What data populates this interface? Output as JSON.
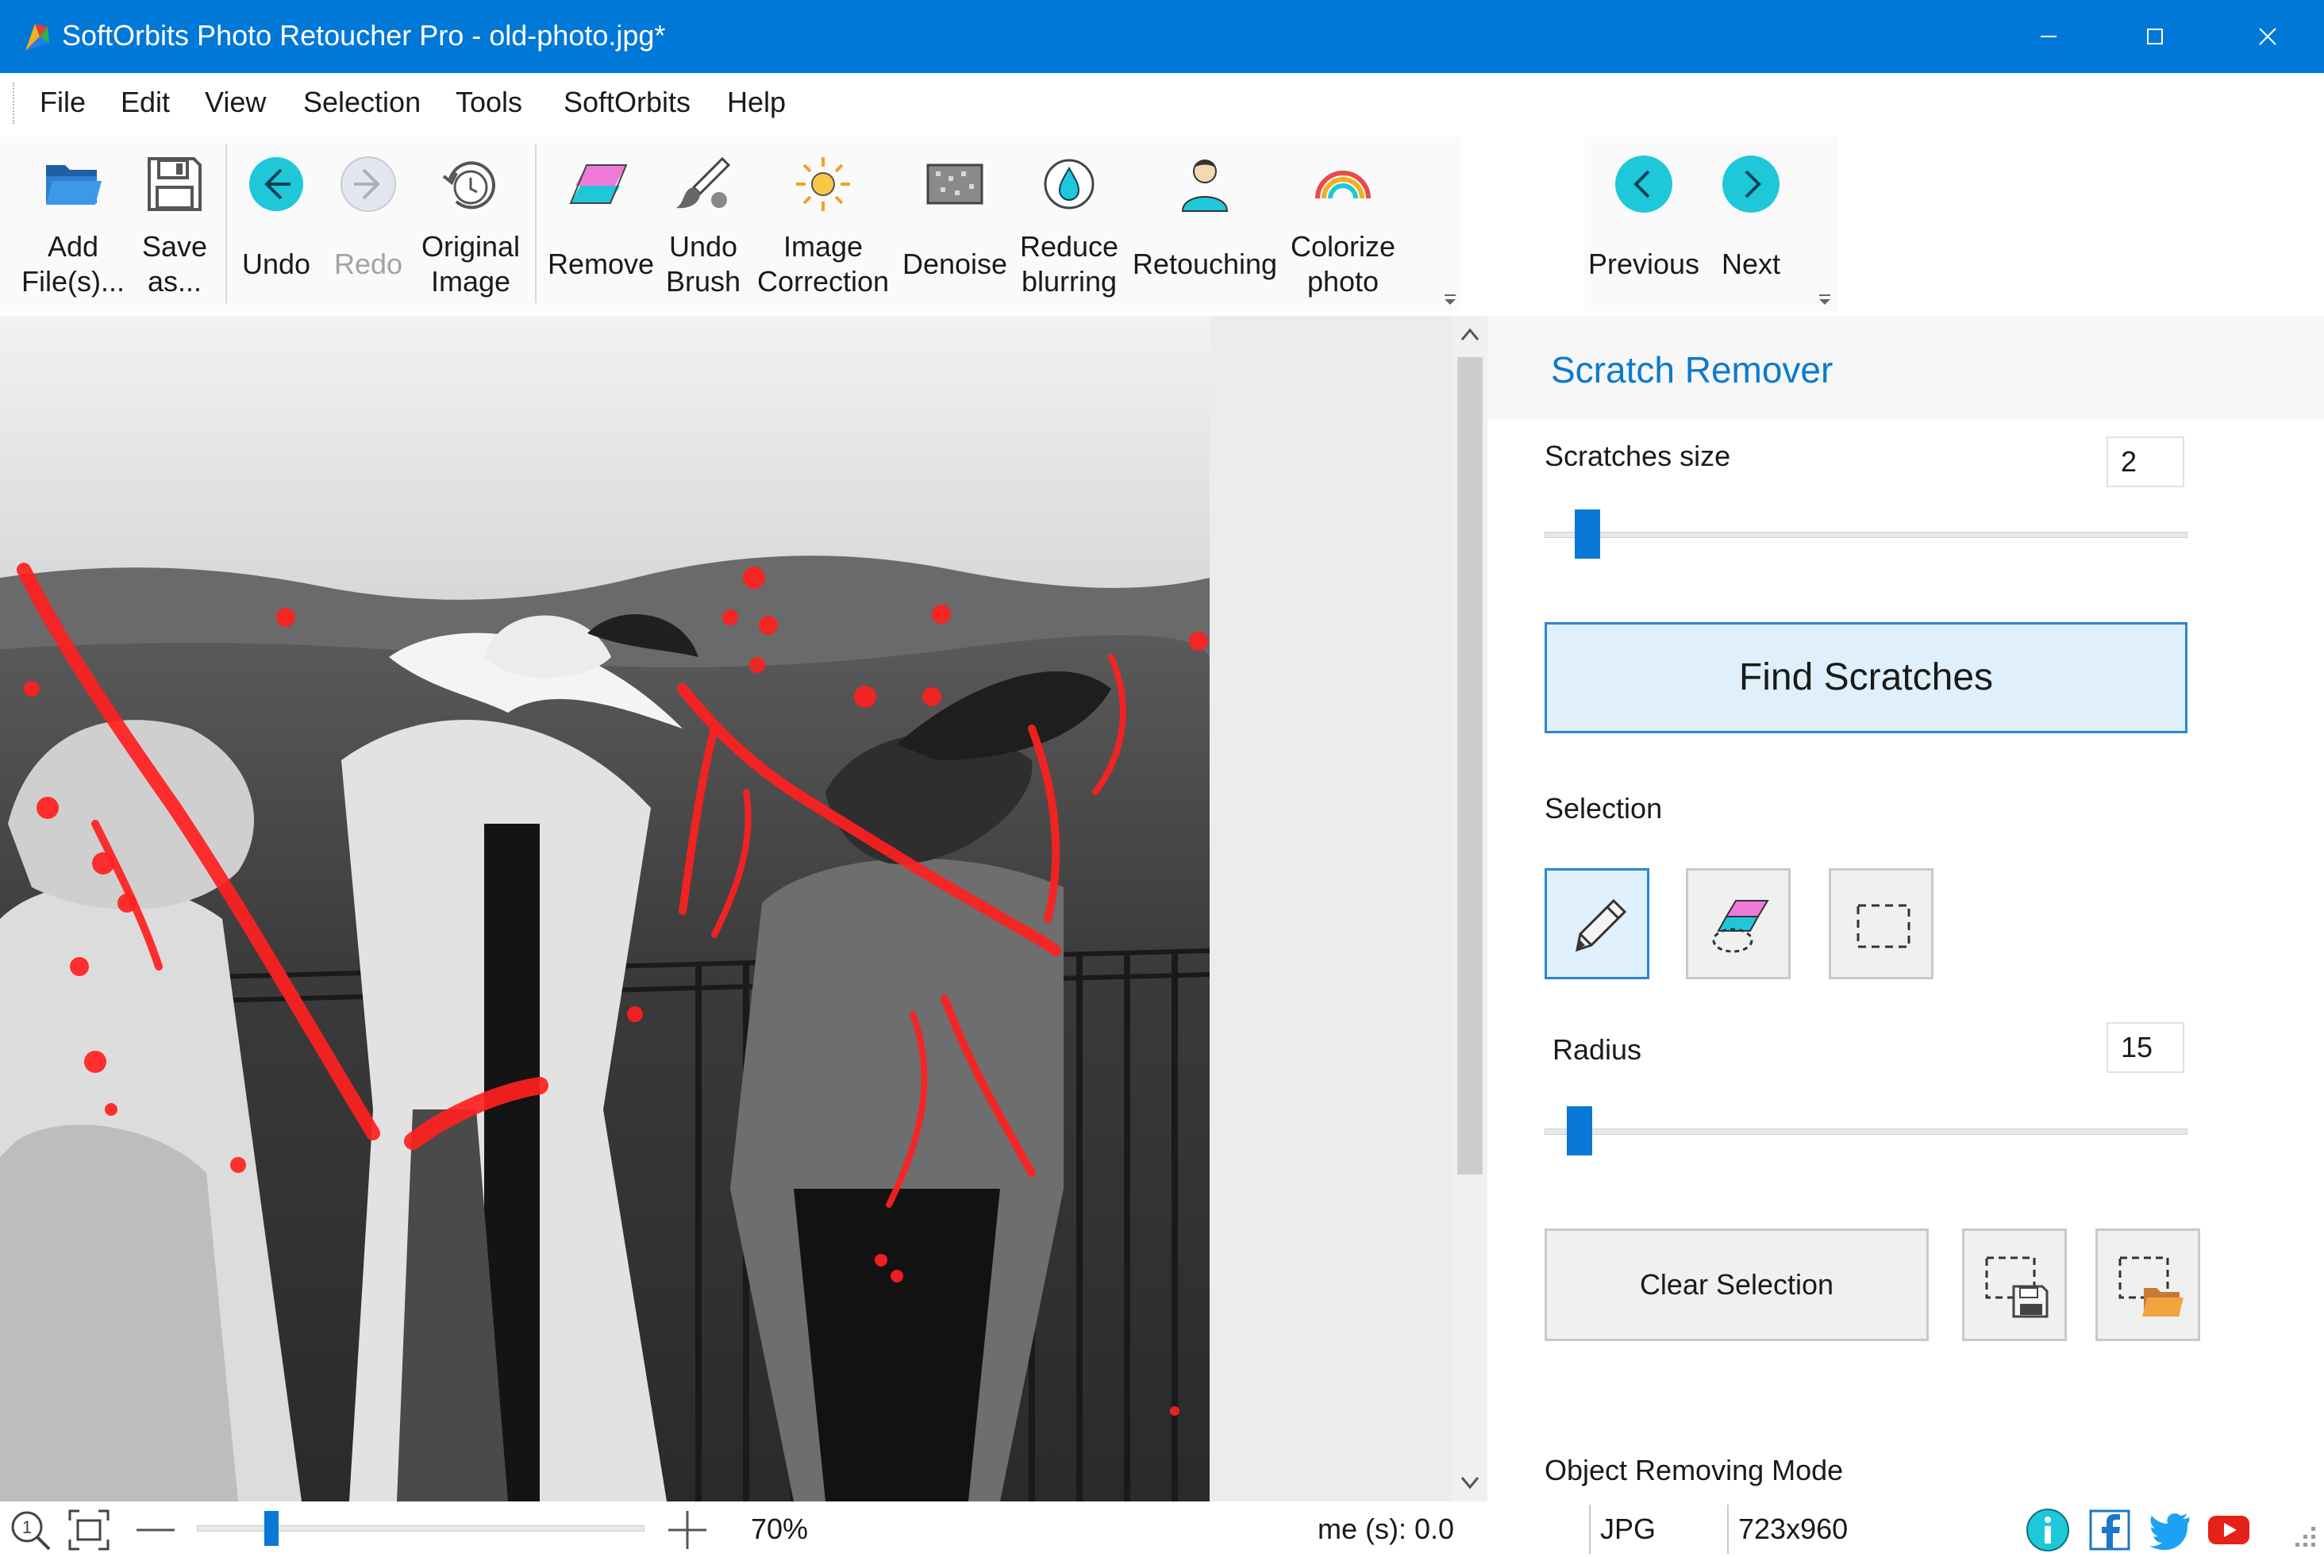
{
  "window": {
    "title": "SoftOrbits Photo Retoucher Pro - old-photo.jpg*",
    "minimize_icon": "minimize-icon",
    "maximize_icon": "maximize-icon",
    "close_icon": "close-icon"
  },
  "menu": [
    "File",
    "Edit",
    "View",
    "Selection",
    "Tools",
    "SoftOrbits",
    "Help"
  ],
  "toolbar": {
    "add_files": [
      "Add",
      "File(s)..."
    ],
    "save_as": [
      "Save",
      "as..."
    ],
    "undo": "Undo",
    "redo": "Redo",
    "original_image": [
      "Original",
      "Image"
    ],
    "remove": "Remove",
    "undo_brush": [
      "Undo",
      "Brush"
    ],
    "image_correction": [
      "Image",
      "Correction"
    ],
    "denoise": "Denoise",
    "reduce_blurring": [
      "Reduce",
      "blurring"
    ],
    "retouching": "Retouching",
    "colorize_photo": [
      "Colorize",
      "photo"
    ],
    "previous": "Previous",
    "next": "Next"
  },
  "panel": {
    "title": "Scratch Remover",
    "scratches_size_label": "Scratches size",
    "scratches_size_value": "2",
    "find_scratches": "Find Scratches",
    "selection_label": "Selection",
    "selection_tools": [
      "pencil-icon",
      "eraser-icon",
      "rect-select-icon"
    ],
    "radius_label": "Radius",
    "radius_value": "15",
    "clear_selection": "Clear Selection",
    "object_removing_mode": "Object Removing Mode"
  },
  "status": {
    "zoom_percent": "70%",
    "time": "me (s): 0.0",
    "format": "JPG",
    "dimensions": "723x960"
  },
  "colors": {
    "accent": "#0078d7",
    "selection_mask": "#ff2020",
    "icon_teal": "#1ec8d8"
  }
}
